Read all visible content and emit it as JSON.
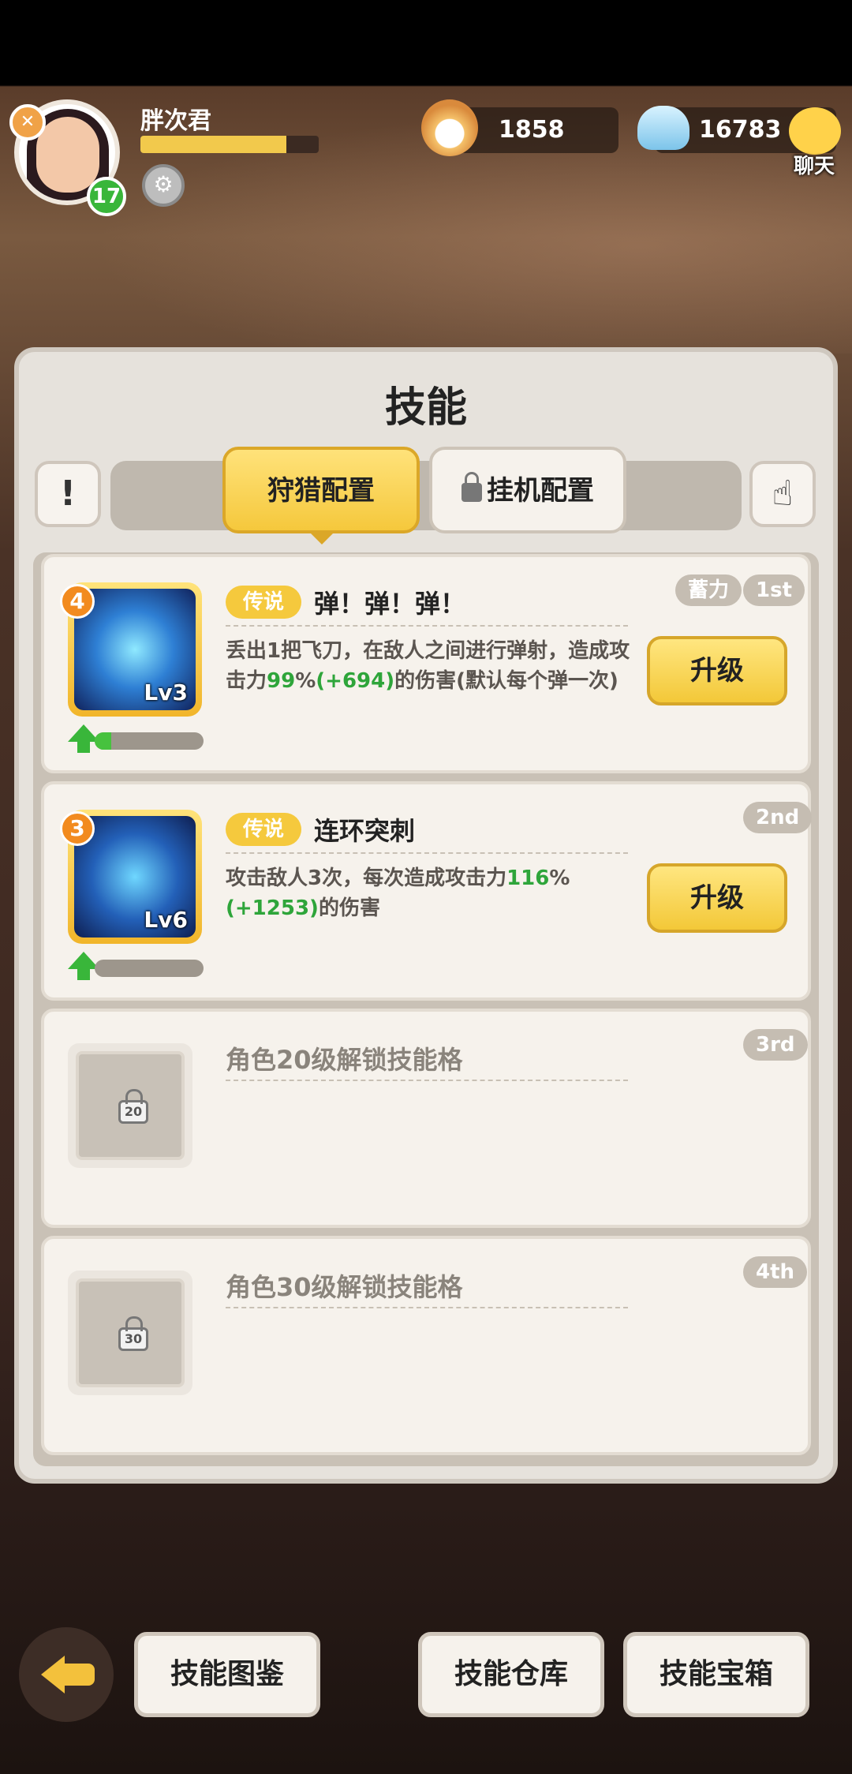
{
  "header": {
    "player_name": "胖次君",
    "player_level": "17",
    "xp_fraction": 0.82,
    "pearls": "1858",
    "diamonds": "16783",
    "chat_label": "聊天"
  },
  "panel": {
    "title": "技能",
    "tabs": [
      {
        "label": "狩猎配置",
        "active": true
      },
      {
        "label": "挂机配置",
        "active": false,
        "locked": true
      }
    ]
  },
  "skills": [
    {
      "slot": "1st",
      "extra_tag": "蓄力",
      "stars": "4",
      "level": "Lv3",
      "rarity": "传说",
      "name": "弹！弹！弹！",
      "desc_pre": "丢出1把飞刀，在敌人之间进行弹射，造成攻击力",
      "desc_pct": "99",
      "desc_pct_sign": "%",
      "desc_bonus_open": "(",
      "desc_bonus": "+694",
      "desc_bonus_close": ")",
      "desc_post": "的伤害(默认每个弹一次)",
      "progress": 0.15,
      "upgrade_label": "升级"
    },
    {
      "slot": "2nd",
      "stars": "3",
      "level": "Lv6",
      "rarity": "传说",
      "name": "连环突刺",
      "desc_pre": "攻击敌人3次，每次造成攻击力",
      "desc_pct": "116",
      "desc_pct_sign": "%",
      "desc_bonus_open": "(",
      "desc_bonus": "+1253",
      "desc_bonus_close": ")",
      "desc_post": "的伤害",
      "progress": 0.0,
      "upgrade_label": "升级"
    }
  ],
  "locked_slots": [
    {
      "slot": "3rd",
      "text": "角色20级解锁技能格",
      "level": "20"
    },
    {
      "slot": "4th",
      "text": "角色30级解锁技能格",
      "level": "30"
    }
  ],
  "bottom": {
    "codex": "技能图鉴",
    "warehouse": "技能仓库",
    "chest": "技能宝箱"
  },
  "colors": {
    "accent_yellow": "#f5c83c",
    "green_value": "#2ea53a",
    "panel_bg": "#e6e2dc"
  }
}
